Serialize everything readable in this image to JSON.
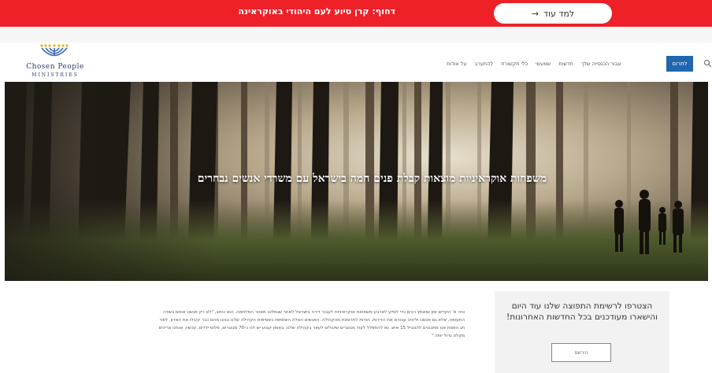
{
  "alert": {
    "text": "דחוף: קרן סיוע לעם היהודי באוקראינה",
    "cta_label": "למד עוד",
    "cta_arrow": "→",
    "color": "#ee2128"
  },
  "logo": {
    "name": "Chosen People",
    "subtitle": "MINISTRIES"
  },
  "nav": {
    "items": [
      {
        "label": "עבור הכנסייה שלך"
      },
      {
        "label": "חדשות"
      },
      {
        "label": "שמעשי"
      },
      {
        "label": "כלי תקשורת"
      },
      {
        "label": "להתערב"
      },
      {
        "label": "על אודות"
      }
    ],
    "donate_label": "לתרום",
    "search_icon": "search-icon",
    "donate_color": "#2167ad"
  },
  "hero": {
    "title": "משפחות אוקראיניות מוצאות קבלת פנים חמה בישראל עם משרדי אנשים נבחרים"
  },
  "article": {
    "text": "נויה א' הקדיש זמן ומאמץ רבים כדי לסייע לארבע משפחות אוקראיניות לעבור דירה בישראל לאחר שנמלטו מאזור המלחמה. הוא כותב, \"לא רק פגשנו אותם בשדה התעופה, אלא גם פגשנו וליווינו עבורם את הדירות, הודות לתרומות מהקהילה. האנשים האלה השתתפו באסיפות הקהילה שלנו ונהנו מהם כבר קיבלו את האדון. לפני חג הפסח אנו מתכננים להטביל 15 איש. נא להתפלל לעוד מבוגרים שיכולים לעזור בקהילה שלנו. באופן קבוע יש לנו כ-70 מבוגרים, פלוס ילדים. עכשיו, אנחנו צריכים מקלט גדול יותר.\""
  },
  "newsletter": {
    "text": "הצטרפו לרשימת התפוצה שלנו עוד היום והישארו מעודכנים בכל החדשות האחרונות!",
    "button_label": "הירשם"
  }
}
